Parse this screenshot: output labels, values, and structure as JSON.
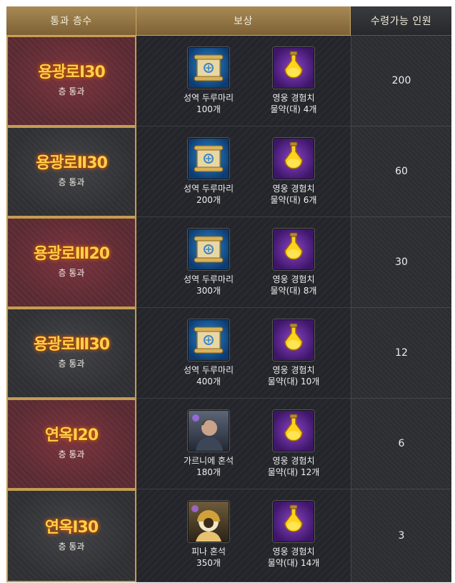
{
  "header": {
    "stage_label": "통과 층수",
    "reward_label": "보상",
    "count_label": "수령가능 인원"
  },
  "rows": [
    {
      "stage": "용광로Ⅰ30",
      "stage_sub": "층 통과",
      "reward1": {
        "icon": "scroll-icon",
        "line1": "성역 두루마리",
        "line2": "100개"
      },
      "reward2": {
        "icon": "potion-icon",
        "line1": "영웅 경험치",
        "line2": "물약(대) 4개"
      },
      "count": "200"
    },
    {
      "stage": "용광로Ⅱ30",
      "stage_sub": "층 통과",
      "reward1": {
        "icon": "scroll-icon",
        "line1": "성역 두루마리",
        "line2": "200개"
      },
      "reward2": {
        "icon": "potion-icon",
        "line1": "영웅 경험치",
        "line2": "물약(대) 6개"
      },
      "count": "60"
    },
    {
      "stage": "용광로Ⅲ20",
      "stage_sub": "층 통과",
      "reward1": {
        "icon": "scroll-icon",
        "line1": "성역 두루마리",
        "line2": "300개"
      },
      "reward2": {
        "icon": "potion-icon",
        "line1": "영웅 경험치",
        "line2": "물약(대) 8개"
      },
      "count": "30"
    },
    {
      "stage": "용광로Ⅲ30",
      "stage_sub": "층 통과",
      "reward1": {
        "icon": "scroll-icon",
        "line1": "성역 두루마리",
        "line2": "400개"
      },
      "reward2": {
        "icon": "potion-icon",
        "line1": "영웅 경험치",
        "line2": "물약(대) 10개"
      },
      "count": "12"
    },
    {
      "stage": "연옥Ⅰ20",
      "stage_sub": "층 통과",
      "reward1": {
        "icon": "hero-garnie-icon",
        "line1": "가르니에 혼석",
        "line2": "180개"
      },
      "reward2": {
        "icon": "potion-icon",
        "line1": "영웅 경험치",
        "line2": "물약(대) 12개"
      },
      "count": "6"
    },
    {
      "stage": "연옥Ⅰ30",
      "stage_sub": "층 통과",
      "reward1": {
        "icon": "hero-pina-icon",
        "line1": "피나 혼석",
        "line2": "350개"
      },
      "reward2": {
        "icon": "potion-icon",
        "line1": "영웅 경험치",
        "line2": "물약(대) 14개"
      },
      "count": "3"
    }
  ]
}
